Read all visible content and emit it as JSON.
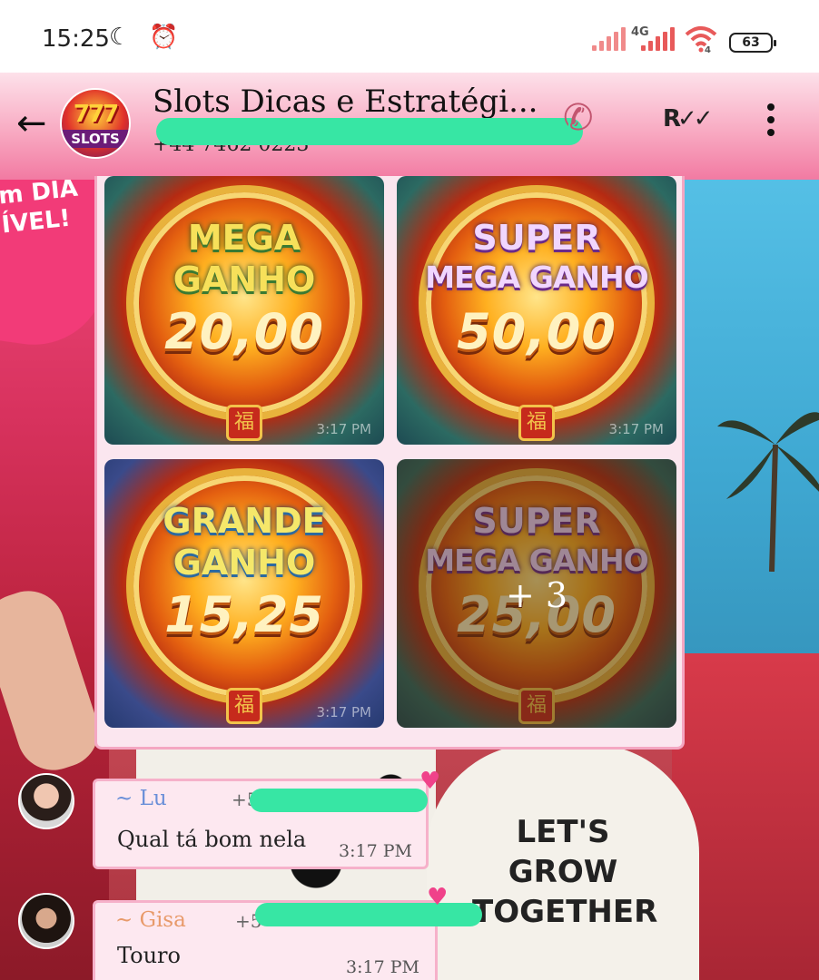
{
  "status_bar": {
    "time": "15:25",
    "network_label": "4G",
    "wifi_label": "4",
    "battery": "63"
  },
  "header": {
    "title": "Slots Dicas e Estratégi...",
    "subtitle": "+44 7462 0223",
    "avatar_top": "777",
    "avatar_bottom": "SLOTS"
  },
  "wallpaper": {
    "heart_text": "m DIA\nÍVEL!",
    "shirt_text": "LET'S\nGROW\nTOGETHER"
  },
  "media": {
    "tiles": [
      {
        "line1": "MEGA",
        "line2": "GANHO",
        "amount": "20,00",
        "time": "3:17 PM",
        "seal": "福"
      },
      {
        "line1": "SUPER",
        "line2": "MEGA GANHO",
        "amount": "50,00",
        "time": "3:17 PM",
        "seal": "福"
      },
      {
        "line1": "GRANDE",
        "line2": "GANHO",
        "amount": "15,25",
        "time": "3:17 PM",
        "seal": "福"
      },
      {
        "line1": "SUPER",
        "line2": "MEGA GANHO",
        "amount": "25,00",
        "time": "",
        "seal": "福"
      }
    ],
    "more_count": "+ 3"
  },
  "messages": [
    {
      "sender": "~ Lu",
      "sender_color": "#6a8fd8",
      "phone_prefix": "+5",
      "text": "Qual tá bom nela",
      "time": "3:17 PM"
    },
    {
      "sender": "~ Gisa",
      "sender_color": "#e89a6a",
      "phone_prefix": "+5",
      "text": "Touro",
      "time": "3:17 PM"
    }
  ],
  "colors": {
    "header_pink": "#f27aa2",
    "bubble_border": "#f6b1ca",
    "redaction": "#37e6a4"
  }
}
